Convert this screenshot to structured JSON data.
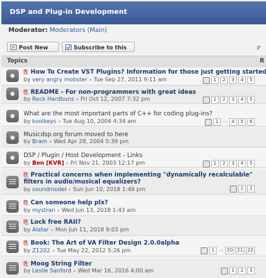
{
  "forum": {
    "title": "DSP and Plug-in Development"
  },
  "moderator": {
    "label": "Moderator:",
    "value": "Moderators (Main)"
  },
  "buttons": {
    "new_topic": "Post New Topic",
    "subscribe": "Subscribe to this forum"
  },
  "truncated_right": "P",
  "topics_header": {
    "label": "Topics",
    "right": "R"
  },
  "topics": [
    {
      "title": "How To Create VST Plugins? Information for those just getting started",
      "by": "by",
      "author": "very angry mobster",
      "date": "Tue Sep 27, 2011 9:11 am",
      "pages": [
        "1",
        "2",
        "3",
        "4",
        "5"
      ]
    },
    {
      "title": "README - For non-programmers with great ideas",
      "by": "by",
      "author": "Rock Hardbuns",
      "date": "Fri Oct 12, 2007 7:32 pm",
      "pages": [
        "1",
        "2",
        "3",
        "4",
        "5"
      ]
    },
    {
      "title": "What are the most important parts of C++ for coding plug-ins?",
      "by": "by",
      "author": "koolkeys",
      "date": "Tue Aug 10, 2004 4:34 am",
      "pages": [
        "1",
        "…",
        "4",
        "5",
        "6"
      ]
    },
    {
      "title": "Musicdsp.org forum moved to here",
      "by": "by",
      "author": "Bram",
      "date": "Wed Apr 28, 2004 5:39 pm",
      "pages": []
    },
    {
      "title": "DSP / Plugin / Host Development - Links",
      "by": "by",
      "author": "Ben [KVR]",
      "date": "Fri Nov 21, 2003 12:17 pm",
      "pages": [
        "1",
        "2",
        "3",
        "4",
        "5"
      ]
    },
    {
      "title": "Practical concerns when implementing \"dynamically recalculable\"",
      "title2": "filters in audio/musical equalizers?",
      "by": "by",
      "author": "soundmodel",
      "date": "Sun Jun 10, 2018 1:49 pm",
      "pages": [
        "1",
        "2"
      ]
    },
    {
      "title": "Can someone help plx?",
      "by": "by",
      "author": "mystran",
      "date": "Wed Jun 13, 2018 1:43 am",
      "pages": []
    },
    {
      "title": "Lock free RAII?",
      "by": "by",
      "author": "Alatar",
      "date": "Mon Jun 11, 2018 9:03 pm",
      "pages": []
    },
    {
      "title": "Book: The Art of VA Filter Design 2.0.0alpha",
      "by": "by",
      "author": "Z1202",
      "date": "Tue May 22, 2012 5:26 pm",
      "pages": [
        "1",
        "…",
        "20",
        "21",
        "22"
      ]
    },
    {
      "title": "Moog String Filter",
      "by": "by",
      "author": "Leslie Sanford",
      "date": "Wed Mar 16, 2016 4:00 am",
      "pages": [
        "1",
        "2",
        "3"
      ]
    }
  ],
  "arrow_glyph": "»",
  "colors": {
    "header_bg": "#3b5a94",
    "link": "#2a5b9b",
    "title": "#1a3a6e",
    "mod_author": "#aa0000"
  }
}
